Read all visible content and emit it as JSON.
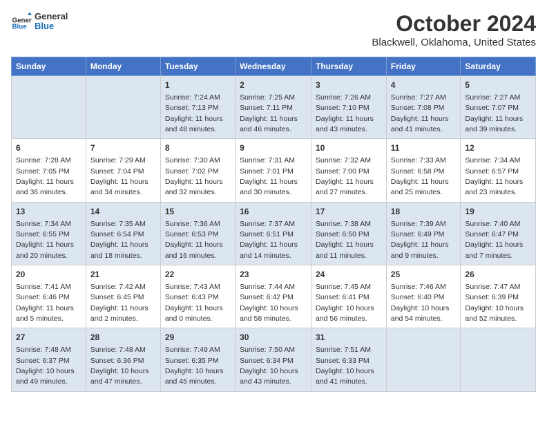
{
  "logo": {
    "general": "General",
    "blue": "Blue"
  },
  "title": "October 2024",
  "subtitle": "Blackwell, Oklahoma, United States",
  "days_of_week": [
    "Sunday",
    "Monday",
    "Tuesday",
    "Wednesday",
    "Thursday",
    "Friday",
    "Saturday"
  ],
  "weeks": [
    [
      {
        "day": "",
        "info": ""
      },
      {
        "day": "",
        "info": ""
      },
      {
        "day": "1",
        "info": "Sunrise: 7:24 AM\nSunset: 7:13 PM\nDaylight: 11 hours and 48 minutes."
      },
      {
        "day": "2",
        "info": "Sunrise: 7:25 AM\nSunset: 7:11 PM\nDaylight: 11 hours and 46 minutes."
      },
      {
        "day": "3",
        "info": "Sunrise: 7:26 AM\nSunset: 7:10 PM\nDaylight: 11 hours and 43 minutes."
      },
      {
        "day": "4",
        "info": "Sunrise: 7:27 AM\nSunset: 7:08 PM\nDaylight: 11 hours and 41 minutes."
      },
      {
        "day": "5",
        "info": "Sunrise: 7:27 AM\nSunset: 7:07 PM\nDaylight: 11 hours and 39 minutes."
      }
    ],
    [
      {
        "day": "6",
        "info": "Sunrise: 7:28 AM\nSunset: 7:05 PM\nDaylight: 11 hours and 36 minutes."
      },
      {
        "day": "7",
        "info": "Sunrise: 7:29 AM\nSunset: 7:04 PM\nDaylight: 11 hours and 34 minutes."
      },
      {
        "day": "8",
        "info": "Sunrise: 7:30 AM\nSunset: 7:02 PM\nDaylight: 11 hours and 32 minutes."
      },
      {
        "day": "9",
        "info": "Sunrise: 7:31 AM\nSunset: 7:01 PM\nDaylight: 11 hours and 30 minutes."
      },
      {
        "day": "10",
        "info": "Sunrise: 7:32 AM\nSunset: 7:00 PM\nDaylight: 11 hours and 27 minutes."
      },
      {
        "day": "11",
        "info": "Sunrise: 7:33 AM\nSunset: 6:58 PM\nDaylight: 11 hours and 25 minutes."
      },
      {
        "day": "12",
        "info": "Sunrise: 7:34 AM\nSunset: 6:57 PM\nDaylight: 11 hours and 23 minutes."
      }
    ],
    [
      {
        "day": "13",
        "info": "Sunrise: 7:34 AM\nSunset: 6:55 PM\nDaylight: 11 hours and 20 minutes."
      },
      {
        "day": "14",
        "info": "Sunrise: 7:35 AM\nSunset: 6:54 PM\nDaylight: 11 hours and 18 minutes."
      },
      {
        "day": "15",
        "info": "Sunrise: 7:36 AM\nSunset: 6:53 PM\nDaylight: 11 hours and 16 minutes."
      },
      {
        "day": "16",
        "info": "Sunrise: 7:37 AM\nSunset: 6:51 PM\nDaylight: 11 hours and 14 minutes."
      },
      {
        "day": "17",
        "info": "Sunrise: 7:38 AM\nSunset: 6:50 PM\nDaylight: 11 hours and 11 minutes."
      },
      {
        "day": "18",
        "info": "Sunrise: 7:39 AM\nSunset: 6:49 PM\nDaylight: 11 hours and 9 minutes."
      },
      {
        "day": "19",
        "info": "Sunrise: 7:40 AM\nSunset: 6:47 PM\nDaylight: 11 hours and 7 minutes."
      }
    ],
    [
      {
        "day": "20",
        "info": "Sunrise: 7:41 AM\nSunset: 6:46 PM\nDaylight: 11 hours and 5 minutes."
      },
      {
        "day": "21",
        "info": "Sunrise: 7:42 AM\nSunset: 6:45 PM\nDaylight: 11 hours and 2 minutes."
      },
      {
        "day": "22",
        "info": "Sunrise: 7:43 AM\nSunset: 6:43 PM\nDaylight: 11 hours and 0 minutes."
      },
      {
        "day": "23",
        "info": "Sunrise: 7:44 AM\nSunset: 6:42 PM\nDaylight: 10 hours and 58 minutes."
      },
      {
        "day": "24",
        "info": "Sunrise: 7:45 AM\nSunset: 6:41 PM\nDaylight: 10 hours and 56 minutes."
      },
      {
        "day": "25",
        "info": "Sunrise: 7:46 AM\nSunset: 6:40 PM\nDaylight: 10 hours and 54 minutes."
      },
      {
        "day": "26",
        "info": "Sunrise: 7:47 AM\nSunset: 6:39 PM\nDaylight: 10 hours and 52 minutes."
      }
    ],
    [
      {
        "day": "27",
        "info": "Sunrise: 7:48 AM\nSunset: 6:37 PM\nDaylight: 10 hours and 49 minutes."
      },
      {
        "day": "28",
        "info": "Sunrise: 7:48 AM\nSunset: 6:36 PM\nDaylight: 10 hours and 47 minutes."
      },
      {
        "day": "29",
        "info": "Sunrise: 7:49 AM\nSunset: 6:35 PM\nDaylight: 10 hours and 45 minutes."
      },
      {
        "day": "30",
        "info": "Sunrise: 7:50 AM\nSunset: 6:34 PM\nDaylight: 10 hours and 43 minutes."
      },
      {
        "day": "31",
        "info": "Sunrise: 7:51 AM\nSunset: 6:33 PM\nDaylight: 10 hours and 41 minutes."
      },
      {
        "day": "",
        "info": ""
      },
      {
        "day": "",
        "info": ""
      }
    ]
  ]
}
